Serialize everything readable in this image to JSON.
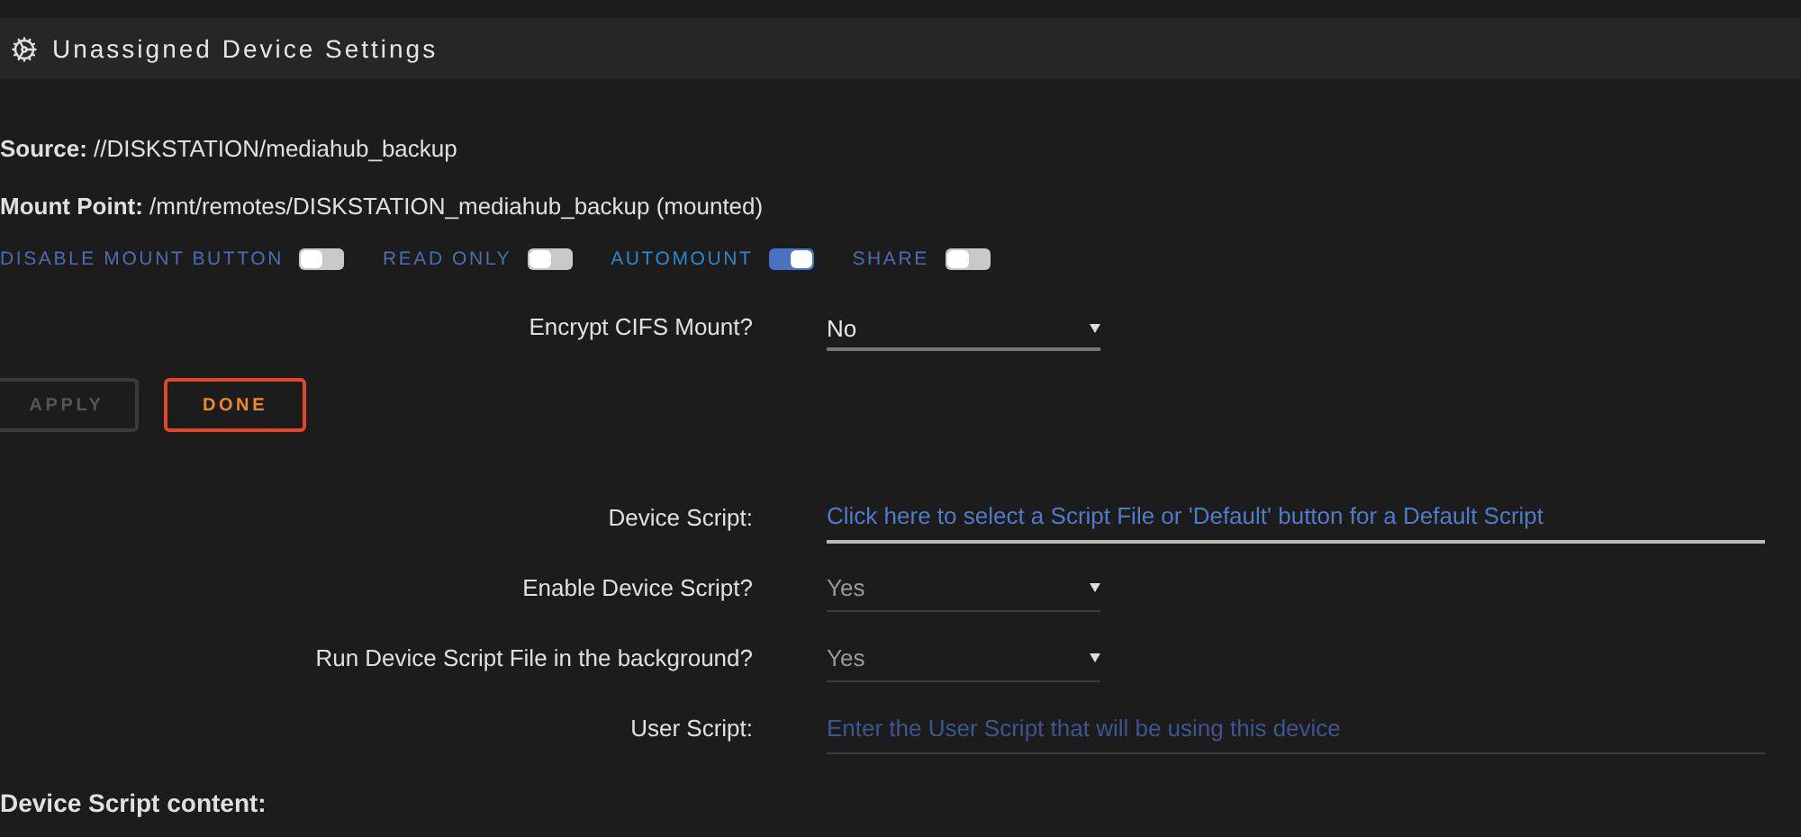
{
  "header": {
    "title": "Unassigned Device Settings"
  },
  "info": [
    {
      "label": "Source:",
      "value": "//DISKSTATION/mediahub_backup"
    },
    {
      "label": "Mount Point:",
      "value": "/mnt/remotes/DISKSTATION_mediahub_backup (mounted)"
    }
  ],
  "toggles": [
    {
      "label": "DISABLE MOUNT BUTTON",
      "on": false
    },
    {
      "label": "READ ONLY",
      "on": false
    },
    {
      "label": "AUTOMOUNT",
      "on": true
    },
    {
      "label": "SHARE",
      "on": false
    }
  ],
  "encrypt": {
    "kind": "select",
    "label": "Encrypt CIFS Mount?",
    "value": "No",
    "disabled": false
  },
  "buttons": [
    {
      "label": "APPLY",
      "disabled": true
    },
    {
      "label": "DONE",
      "disabled": false
    }
  ],
  "script_fields": [
    {
      "kind": "picker",
      "label": "Device Script:",
      "value": "Click here to select a Script File or 'Default' button for a Default Script"
    },
    {
      "kind": "select",
      "label": "Enable Device Script?",
      "value": "Yes",
      "disabled": true
    },
    {
      "kind": "select",
      "label": "Run Device Script File in the background?",
      "value": "Yes",
      "disabled": true
    },
    {
      "kind": "input",
      "label": "User Script:",
      "placeholder": "Enter the User Script that will be using this device"
    }
  ],
  "section_title": "Device Script content:"
}
